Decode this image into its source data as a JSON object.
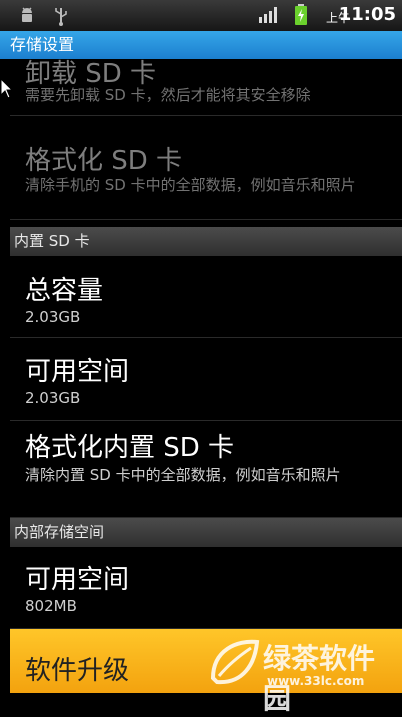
{
  "status_bar": {
    "ampm": "上午",
    "time": "11:05",
    "icons": [
      "android-debug-icon",
      "usb-icon",
      "signal-icon",
      "battery-charging-icon"
    ]
  },
  "title": "存储设置",
  "items": {
    "unmount_sd": {
      "title": "卸载 SD 卡",
      "summary": "需要先卸载 SD 卡，然后才能将其安全移除"
    },
    "format_sd": {
      "title": "格式化 SD 卡",
      "summary": "清除手机的 SD 卡中的全部数据，例如音乐和照片"
    },
    "internal_sd_header": "内置 SD 卡",
    "total_capacity": {
      "title": "总容量",
      "value": "2.03GB"
    },
    "available_space": {
      "title": "可用空间",
      "value": "2.03GB"
    },
    "format_internal_sd": {
      "title": "格式化内置 SD 卡",
      "summary": "清除内置 SD 卡中的全部数据，例如音乐和照片"
    },
    "internal_storage_header": "内部存储空间",
    "internal_available": {
      "title": "可用空间",
      "value": "802MB"
    },
    "software_upgrade": {
      "title": "软件升级"
    }
  },
  "watermark": {
    "name": "绿茶软件园",
    "url": "www.33lc.com"
  }
}
